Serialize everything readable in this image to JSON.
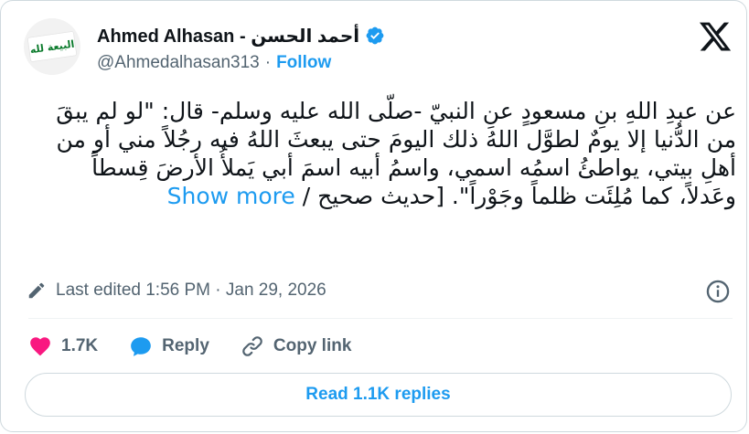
{
  "author": {
    "display_name": "Ahmed Alhasan - أحمد الحسن",
    "handle": "@Ahmedalhasan313",
    "avatar_flag_text": "البيعة لله",
    "separator": "·",
    "follow_label": "Follow",
    "verified_color": "#1d9bf0"
  },
  "post": {
    "text": "عن عبدِ اللهِ بنِ مسعودٍ عنِ النبيّ -صلّى الله عليه وسلم- قال: \"لو لم يبقَ من الدُّنيا إلا يومٌ لطوَّل اللهُ ذلك اليومَ حتى يبعثَ اللهُ فيه رجُلاً مني أو من أهلِ بيتي، يواطئُ اسمُه اسمي، واسمُ أبيه اسمَ أبي يَملأُ الأرضَ قِسطاً وعَدلاً، كما مُلِئَت ظلماً وجَوْراً\". [حديث صحيح / ",
    "show_more_label": "Show more"
  },
  "meta": {
    "edited_text": "Last edited 1:56 PM · Jan 29, 2026"
  },
  "actions": {
    "likes": "1.7K",
    "reply_label": "Reply",
    "copy_link_label": "Copy link"
  },
  "replies_button": "Read 1.1K replies",
  "icons": {
    "verified": "verified-badge-icon",
    "x_logo": "x-logo-icon",
    "pencil": "pencil-icon",
    "info": "info-icon",
    "heart": "heart-icon",
    "reply": "reply-bubble-icon",
    "link": "link-icon"
  },
  "colors": {
    "accent": "#1d9bf0",
    "like": "#f91880",
    "text": "#0f1419",
    "muted": "#536471"
  }
}
